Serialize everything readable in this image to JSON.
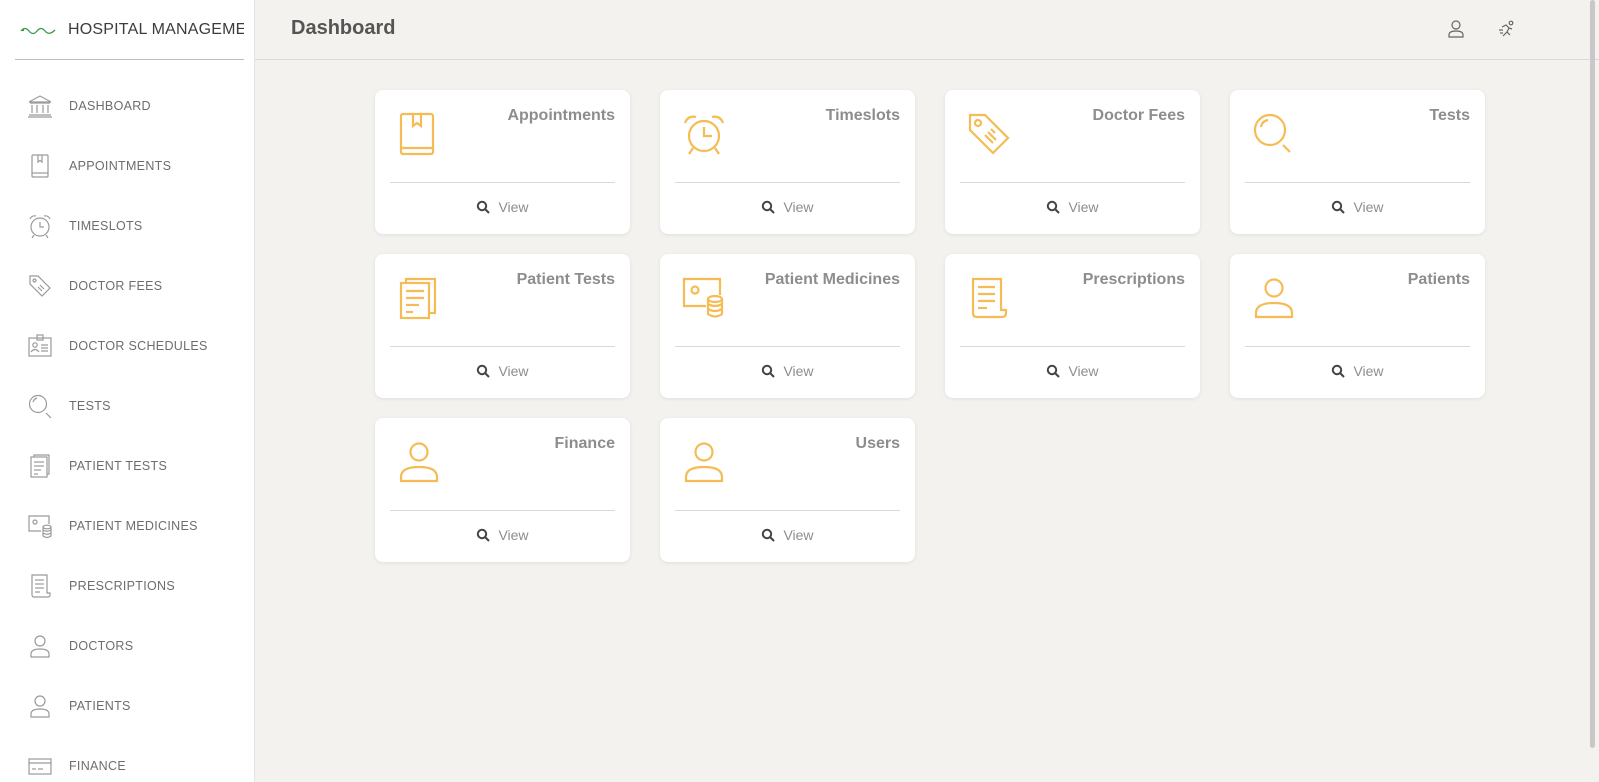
{
  "brand": {
    "name": "HOSPITAL MANAGEMENT",
    "logo_icon": "hospital-logo-icon"
  },
  "header": {
    "title": "Dashboard",
    "profile_icon": "user-icon",
    "logout_icon": "running-person-icon"
  },
  "sidebar": {
    "items": [
      {
        "label": "DASHBOARD",
        "icon": "bank-icon"
      },
      {
        "label": "APPOINTMENTS",
        "icon": "book-icon"
      },
      {
        "label": "TIMESLOTS",
        "icon": "alarm-clock-icon"
      },
      {
        "label": "DOCTOR FEES",
        "icon": "price-tag-icon"
      },
      {
        "label": "DOCTOR SCHEDULES",
        "icon": "id-card-icon"
      },
      {
        "label": "TESTS",
        "icon": "magnifier-icon"
      },
      {
        "label": "PATIENT TESTS",
        "icon": "documents-icon"
      },
      {
        "label": "PATIENT MEDICINES",
        "icon": "money-stack-icon"
      },
      {
        "label": "PRESCRIPTIONS",
        "icon": "receipt-icon"
      },
      {
        "label": "DOCTORS",
        "icon": "user-icon"
      },
      {
        "label": "PATIENTS",
        "icon": "user-icon"
      },
      {
        "label": "FINANCE",
        "icon": "credit-card-icon"
      }
    ]
  },
  "cards": [
    {
      "title": "Appointments",
      "icon": "book-icon",
      "view_label": "View"
    },
    {
      "title": "Timeslots",
      "icon": "alarm-clock-icon",
      "view_label": "View"
    },
    {
      "title": "Doctor Fees",
      "icon": "price-tag-icon",
      "view_label": "View"
    },
    {
      "title": "Tests",
      "icon": "magnifier-icon",
      "view_label": "View"
    },
    {
      "title": "Patient Tests",
      "icon": "documents-icon",
      "view_label": "View"
    },
    {
      "title": "Patient Medicines",
      "icon": "money-stack-icon",
      "view_label": "View"
    },
    {
      "title": "Prescriptions",
      "icon": "receipt-icon",
      "view_label": "View"
    },
    {
      "title": "Patients",
      "icon": "user-icon",
      "view_label": "View"
    },
    {
      "title": "Finance",
      "icon": "user-icon",
      "view_label": "View"
    },
    {
      "title": "Users",
      "icon": "user-icon",
      "view_label": "View"
    }
  ],
  "colors": {
    "accent": "#f5bc55",
    "background": "#f3f2ee",
    "card": "#ffffff"
  }
}
